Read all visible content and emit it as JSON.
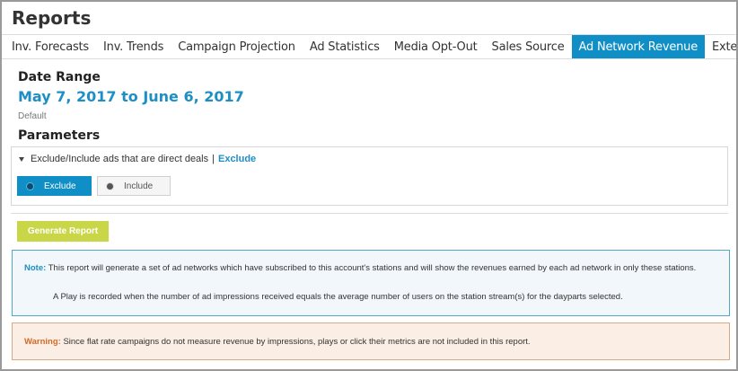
{
  "header": {
    "title": "Reports"
  },
  "tabs": [
    {
      "label": "Inv. Forecasts"
    },
    {
      "label": "Inv. Trends"
    },
    {
      "label": "Campaign Projection"
    },
    {
      "label": "Ad Statistics"
    },
    {
      "label": "Media Opt-Out"
    },
    {
      "label": "Sales Source"
    },
    {
      "label": "Ad Network Revenue",
      "active": true
    },
    {
      "label": "External Network"
    }
  ],
  "date": {
    "section_label": "Date Range",
    "range": "May 7, 2017 to June 6, 2017",
    "preset": "Default"
  },
  "parameters": {
    "section_label": "Parameters",
    "direct_deals": {
      "label": "Exclude/Include ads that are direct deals",
      "separator": "|",
      "current_value": "Exclude",
      "options": [
        {
          "label": "Exclude",
          "selected": true
        },
        {
          "label": "Include",
          "selected": false
        }
      ]
    }
  },
  "actions": {
    "generate_label": "Generate Report"
  },
  "note": {
    "tag": "Note:",
    "line1": "This report will generate a set of ad networks which have subscribed to this account's stations and will show the revenues earned by each ad network in only these stations.",
    "line2": "A Play is recorded when the number of ad impressions received equals the average number of users on the station stream(s) for the dayparts selected."
  },
  "warning": {
    "tag": "Warning:",
    "text": "Since flat rate campaigns do not measure revenue by impressions, plays or click their metrics are not included in this report."
  },
  "colors": {
    "accent": "#0f8fc6",
    "link": "#1d8fc4",
    "generate_button": "#c8d647",
    "warning_tag": "#d46a2a"
  }
}
